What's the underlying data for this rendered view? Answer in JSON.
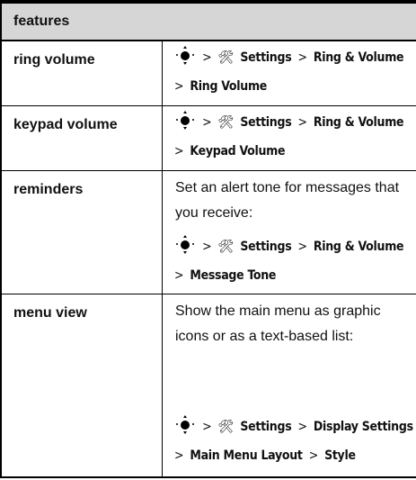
{
  "table": {
    "header": "features",
    "rows": [
      {
        "feature": "ring volume",
        "path": {
          "line1_item1": "Settings",
          "line1_item2": "Ring & Volume",
          "line2_item1": "Ring Volume"
        }
      },
      {
        "feature": "keypad volume",
        "path": {
          "line1_item1": "Settings",
          "line1_item2": "Ring & Volume",
          "line2_item1": "Keypad Volume"
        }
      },
      {
        "feature": "reminders",
        "description": "Set an alert tone for messages that you receive:",
        "path": {
          "line1_item1": "Settings",
          "line1_item2": "Ring & Volume",
          "line2_item1": "Message Tone"
        }
      },
      {
        "feature": "menu view",
        "description": "Show the main menu as graphic icons or as a text-based list:",
        "path": {
          "line1_item1": "Settings",
          "line1_item2": "Display Settings",
          "line2_item1": "Main Menu Layout",
          "line2_item2": "Style"
        }
      }
    ]
  },
  "symbols": {
    "separator": ">",
    "nav_key_icon": "navigation-key-icon",
    "settings_icon": "settings-icon",
    "settings_glyph": "🛠"
  }
}
